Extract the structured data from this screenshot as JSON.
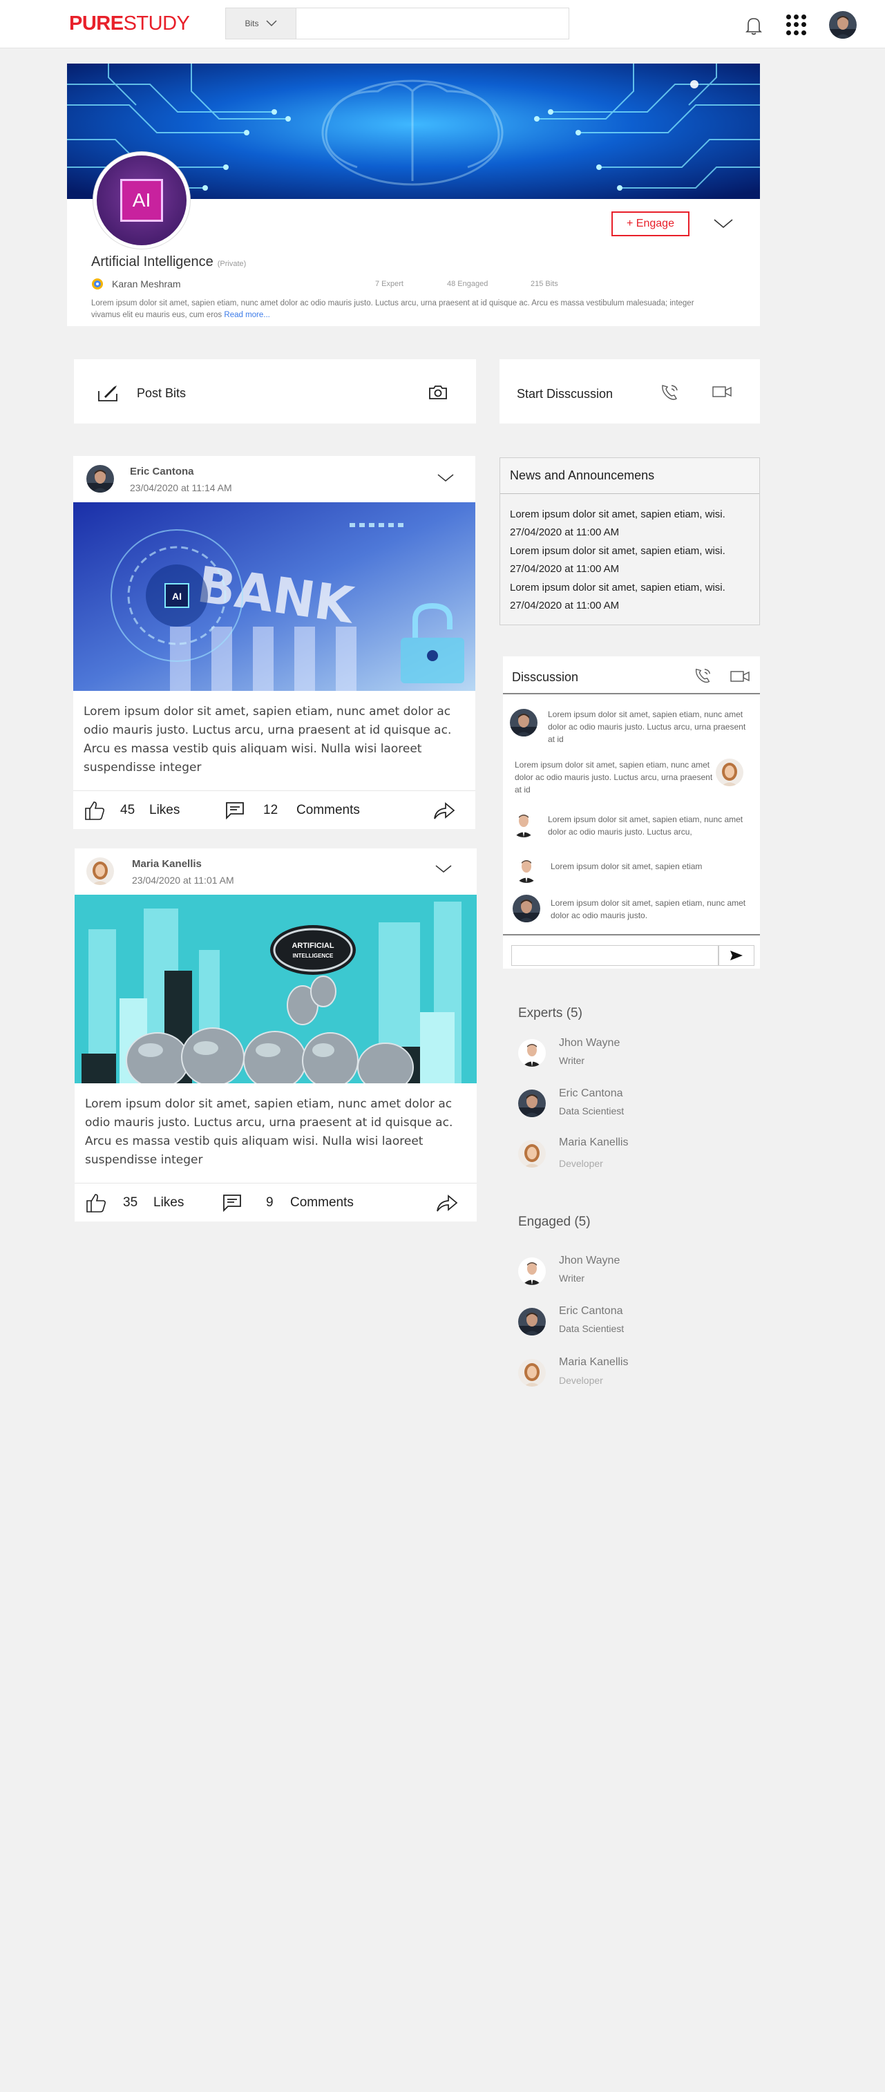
{
  "header": {
    "logo_bold": "PURE",
    "logo_rest": "STUDY",
    "search_scope": "Bits",
    "search_placeholder": ""
  },
  "community": {
    "logo_text": "AI",
    "engage_label": "+ Engage",
    "title": "Artificial Intelligence",
    "privacy": "(Private)",
    "owner": "Karan Meshram",
    "experts_stat": "7 Expert",
    "engaged_stat": "48 Engaged",
    "bits_stat": "215 Bits",
    "description": "Lorem ipsum dolor sit amet, sapien etiam, nunc amet dolor ac odio mauris justo. Luctus arcu, urna praesent at id quisque ac. Arcu es massa vestibulum malesuada; integer vivamus elit eu mauris eus, cum eros",
    "read_more": "Read more..."
  },
  "composer": {
    "post_label": "Post Bits",
    "discussion_label": "Start Disscussion"
  },
  "posts": [
    {
      "author": "Eric Cantona",
      "date": "23/04/2020 at 11:14 AM",
      "image_text": "BANK",
      "image_badge": "AI",
      "text": "Lorem ipsum dolor sit amet, sapien etiam, nunc amet dolor ac odio mauris justo. Luctus arcu, urna praesent at id quisque ac. Arcu es massa vestib quis aliquam wisi. Nulla wisi laoreet suspendisse integer",
      "likes": "45",
      "likes_label": "Likes",
      "comments": "12",
      "comments_label": "Comments"
    },
    {
      "author": "Maria Kanellis",
      "date": "23/04/2020 at 11:01 AM",
      "image_text_1": "ARTIFICIAL",
      "image_text_2": "INTELLIGENCE",
      "text": "Lorem ipsum dolor sit amet, sapien etiam, nunc amet dolor ac odio mauris justo. Luctus arcu, urna praesent at id quisque ac. Arcu es massa vestib quis aliquam wisi. Nulla wisi laoreet suspendisse integer",
      "likes": "35",
      "likes_label": "Likes",
      "comments": "9",
      "comments_label": "Comments"
    }
  ],
  "news": {
    "title": "News and Announcemens",
    "items": [
      {
        "text": "Lorem ipsum dolor sit amet, sapien etiam, wisi.",
        "date": "27/04/2020 at 11:00 AM"
      },
      {
        "text": "Lorem ipsum dolor sit amet, sapien etiam, wisi.",
        "date": "27/04/2020 at 11:00 AM"
      },
      {
        "text": "Lorem ipsum dolor sit amet, sapien etiam, wisi.",
        "date": "27/04/2020 at 11:00 AM"
      }
    ]
  },
  "discussion": {
    "title": "Disscussion",
    "messages": [
      "Lorem ipsum dolor sit amet, sapien etiam, nunc amet dolor ac odio mauris justo. Luctus arcu, urna praesent at id",
      "Lorem ipsum dolor sit amet, sapien etiam, nunc amet dolor ac odio mauris justo. Luctus arcu, urna praesent at id",
      "Lorem ipsum dolor sit amet, sapien etiam, nunc amet dolor ac odio mauris justo. Luctus arcu,",
      "Lorem ipsum dolor sit amet, sapien etiam",
      "Lorem ipsum dolor sit amet, sapien etiam, nunc amet dolor ac odio mauris justo."
    ]
  },
  "experts": {
    "title": "Experts (5)",
    "people": [
      {
        "name": "Jhon Wayne",
        "role": "Writer"
      },
      {
        "name": "Eric Cantona",
        "role": "Data Scientiest"
      },
      {
        "name": "Maria Kanellis",
        "role": "Developer"
      }
    ]
  },
  "engaged": {
    "title": "Engaged (5)",
    "people": [
      {
        "name": "Jhon Wayne",
        "role": "Writer"
      },
      {
        "name": "Eric Cantona",
        "role": "Data Scientiest"
      },
      {
        "name": "Maria Kanellis",
        "role": "Developer"
      }
    ]
  },
  "colors": {
    "brand": "#e8202a",
    "link": "#3c7be8",
    "page_bg": "#f1f1f1"
  },
  "icons": {
    "bell": "bell-icon",
    "apps": "apps-grid-icon",
    "camera": "camera-icon",
    "phone": "phone-call-icon",
    "video": "video-icon",
    "like": "thumbs-up-icon",
    "comment": "comment-icon",
    "share": "share-icon",
    "send": "send-icon"
  }
}
